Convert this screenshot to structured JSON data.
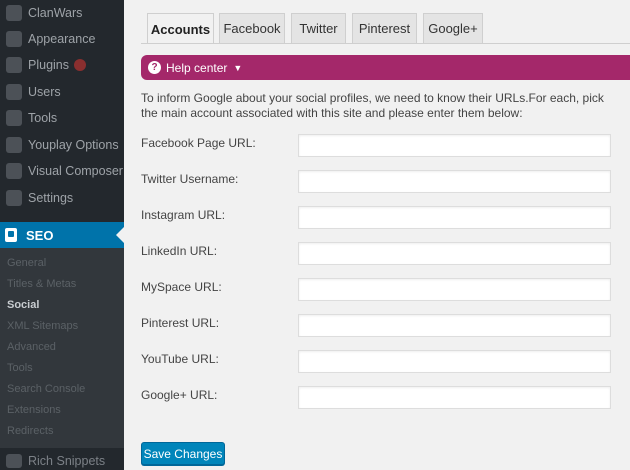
{
  "sidebar": {
    "items": [
      {
        "label": "ClanWars",
        "icon": "clan-wars-icon"
      },
      {
        "label": "Appearance",
        "icon": "appearance-icon"
      },
      {
        "label": "Plugins",
        "icon": "plugins-icon",
        "badge": true
      },
      {
        "label": "Users",
        "icon": "users-icon"
      },
      {
        "label": "Tools",
        "icon": "tools-icon"
      },
      {
        "label": "Youplay Options",
        "icon": "youplay-options-icon"
      },
      {
        "label": "Visual Composer",
        "icon": "visual-composer-icon"
      },
      {
        "label": "Settings",
        "icon": "settings-icon"
      }
    ],
    "current": {
      "label": "SEO",
      "icon": "yoast-seo-icon",
      "accent": "#0073aa"
    },
    "submenu": [
      {
        "label": "General"
      },
      {
        "label": "Titles & Metas"
      },
      {
        "label": "Social",
        "current": true
      },
      {
        "label": "XML Sitemaps"
      },
      {
        "label": "Advanced"
      },
      {
        "label": "Tools"
      },
      {
        "label": "Search Console"
      },
      {
        "label": "Extensions"
      },
      {
        "label": "Redirects"
      }
    ],
    "bottom": {
      "label": "Rich Snippets",
      "icon": "rich-snippets-icon"
    }
  },
  "tabs": [
    {
      "label": "Accounts",
      "active": true
    },
    {
      "label": "Facebook"
    },
    {
      "label": "Twitter"
    },
    {
      "label": "Pinterest"
    },
    {
      "label": "Google+"
    }
  ],
  "help": {
    "label": "Help center",
    "icon": "question-icon",
    "color": "#a4286a"
  },
  "intro": "To inform Google about your social profiles, we need to know their URLs.For each, pick the main account associated with this site and please enter them below:",
  "fields": [
    {
      "label": "Facebook Page URL:",
      "value": ""
    },
    {
      "label": "Twitter Username:",
      "value": ""
    },
    {
      "label": "Instagram URL:",
      "value": ""
    },
    {
      "label": "LinkedIn URL:",
      "value": ""
    },
    {
      "label": "MySpace URL:",
      "value": ""
    },
    {
      "label": "Pinterest URL:",
      "value": ""
    },
    {
      "label": "YouTube URL:",
      "value": ""
    },
    {
      "label": "Google+ URL:",
      "value": ""
    }
  ],
  "save_label": "Save Changes",
  "colors": {
    "primary_button": "#0085ba",
    "sidebar": "#23282d"
  }
}
